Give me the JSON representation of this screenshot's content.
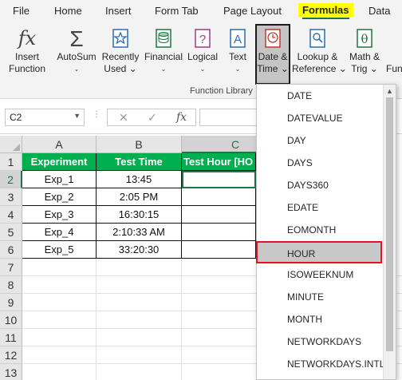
{
  "tabs": [
    "File",
    "Home",
    "Insert",
    "Form Tab",
    "Page Layout",
    "Formulas",
    "Data"
  ],
  "ribbon": {
    "buttons": [
      {
        "line1": "Insert",
        "line2": "Function",
        "icon": "fx-icon"
      },
      {
        "line1": "AutoSum",
        "line2": "⌄",
        "icon": "sigma-icon"
      },
      {
        "line1": "Recently",
        "line2": "Used ⌄",
        "icon": "star-book-icon"
      },
      {
        "line1": "Financial",
        "line2": "⌄",
        "icon": "coins-icon"
      },
      {
        "line1": "Logical",
        "line2": "⌄",
        "icon": "question-book-icon"
      },
      {
        "line1": "Text",
        "line2": "⌄",
        "icon": "letter-a-icon"
      },
      {
        "line1": "Date &",
        "line2": "Time ⌄",
        "icon": "clock-book-icon"
      },
      {
        "line1": "Lookup &",
        "line2": "Reference ⌄",
        "icon": "magnifier-book-icon"
      },
      {
        "line1": "Math &",
        "line2": "Trig ⌄",
        "icon": "theta-book-icon"
      },
      {
        "line1": "Fun",
        "line2": "",
        "icon": ""
      }
    ],
    "group_label": "Function Library",
    "accent": "#217346",
    "highlight": "#ffff00"
  },
  "formula_bar": {
    "name_box": "C2",
    "fx_label": "fx",
    "value": ""
  },
  "sheet": {
    "columns": [
      "A",
      "B",
      "C"
    ],
    "rows": [
      "1",
      "2",
      "3",
      "4",
      "5",
      "6",
      "7",
      "8",
      "9",
      "10",
      "11",
      "12",
      "13"
    ],
    "header": [
      "Experiment",
      "Test Time",
      "Test Hour [HO"
    ],
    "data": [
      [
        "Exp_1",
        "13:45"
      ],
      [
        "Exp_2",
        "2:05 PM"
      ],
      [
        "Exp_3",
        "16:30:15"
      ],
      [
        "Exp_4",
        "2:10:33 AM"
      ],
      [
        "Exp_5",
        "33:20:30"
      ]
    ],
    "header_fill": "#00b050"
  },
  "dropdown": {
    "items": [
      "DATE",
      "DATEVALUE",
      "DAY",
      "DAYS",
      "DAYS360",
      "EDATE",
      "EOMONTH",
      "HOUR",
      "ISOWEEKNUM",
      "MINUTE",
      "MONTH",
      "NETWORKDAYS",
      "NETWORKDAYS.INTL"
    ],
    "highlighted": "HOUR",
    "highlight_border": "#e81123"
  }
}
